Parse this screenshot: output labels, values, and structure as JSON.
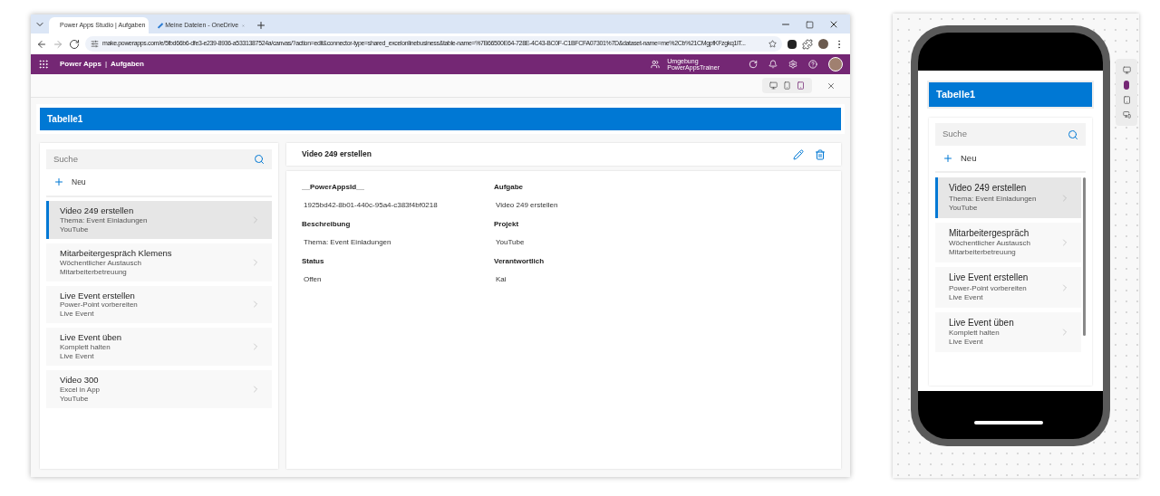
{
  "browser": {
    "tabs": [
      {
        "title": "Power Apps Studio | Aufgaben",
        "selected": true
      },
      {
        "title": "Meine Dateien - OneDrive",
        "selected": false
      }
    ],
    "url": "make.powerapps.com/e/5fbd66b6-dfe3-e239-8936-a5331387524a/canvas/?action=edit&connector-type=shared_excelonlinebusiness&table-name=%7B66500E64-728E-4C43-BC0F-C1BFCFA07301%7D&dataset-name=me%2Cb%21CMgpfKFzgkq1IT..."
  },
  "app_header": {
    "brand": "Power Apps",
    "separator": "|",
    "app_name": "Aufgaben",
    "environment_label": "Umgebung",
    "environment": "PowerAppsTrainer"
  },
  "canvas": {
    "header_title": "Tabelle1",
    "search": {
      "placeholder": "Suche"
    },
    "new_button": "Neu",
    "items": [
      {
        "title": "Video 249 erstellen",
        "subtitle": "Thema: Event Einladungen",
        "category": "YouTube",
        "selected": true
      },
      {
        "title": "Mitarbeitergespräch Klemens",
        "subtitle": "Wöchentlicher Austausch",
        "category": "Mitarbeiterbetreuung",
        "selected": false
      },
      {
        "title": "Live Event erstellen",
        "subtitle": "Power-Point vorbereiten",
        "category": "Live Event",
        "selected": false
      },
      {
        "title": "Live Event üben",
        "subtitle": "Komplett halten",
        "category": "Live Event",
        "selected": false
      },
      {
        "title": "Video 300",
        "subtitle": "Excel in App",
        "category": "YouTube",
        "selected": false
      }
    ],
    "detail": {
      "title": "Video 249 erstellen",
      "fields": [
        {
          "label": "__PowerAppsId__",
          "value": "1925bd42-8b01-440c-95a4-c383f4bf0218"
        },
        {
          "label": "Aufgabe",
          "value": "Video 249 erstellen"
        },
        {
          "label": "Beschreibung",
          "value": "Thema: Event Einladungen"
        },
        {
          "label": "Projekt",
          "value": "YouTube"
        },
        {
          "label": "Status",
          "value": "Offen"
        },
        {
          "label": "Verantwortlich",
          "value": "Kai"
        }
      ]
    }
  },
  "phone": {
    "header_title": "Tabelle1",
    "search": {
      "placeholder": "Suche"
    },
    "new_button": "Neu",
    "items": [
      {
        "title": "Video 249 erstellen",
        "subtitle": "Thema: Event Einladungen",
        "category": "YouTube",
        "selected": true
      },
      {
        "title": "Mitarbeitergespräch",
        "subtitle": "Wöchentlicher Austausch",
        "category": "Mitarbeiterbetreuung",
        "selected": false
      },
      {
        "title": "Live Event erstellen",
        "subtitle": "Power-Point vorbereiten",
        "category": "Live Event",
        "selected": false
      },
      {
        "title": "Live Event üben",
        "subtitle": "Komplett halten",
        "category": "Live Event",
        "selected": false
      }
    ]
  }
}
